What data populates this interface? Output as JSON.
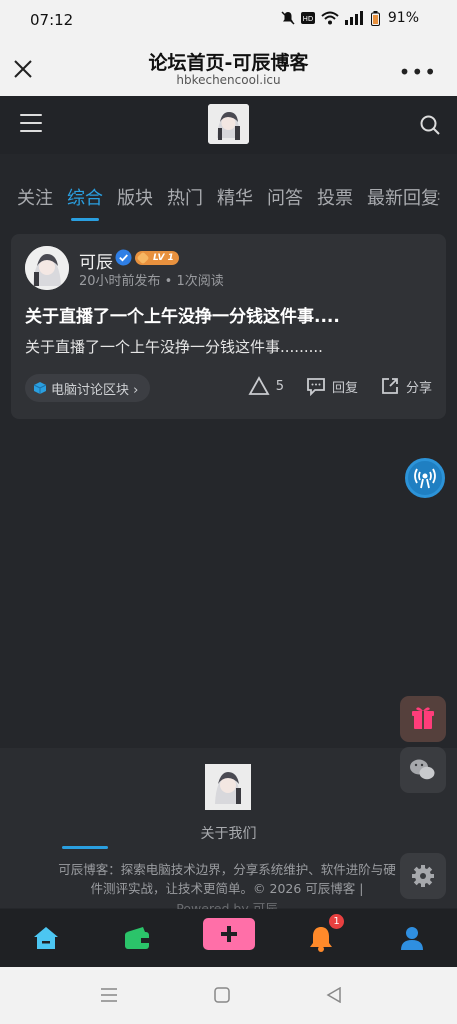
{
  "status_bar": {
    "time": "07:12",
    "battery": "91%",
    "icons": [
      "mute-icon",
      "hd-icon",
      "wifi-icon",
      "signal-icon",
      "battery-icon"
    ]
  },
  "browser": {
    "title": "论坛首页-可辰博客",
    "url": "hbkechencool.icu",
    "menu_label": "•••"
  },
  "tabs": [
    {
      "label": "关注",
      "active": false
    },
    {
      "label": "综合",
      "active": true
    },
    {
      "label": "版块",
      "active": false
    },
    {
      "label": "热门",
      "active": false
    },
    {
      "label": "精华",
      "active": false
    },
    {
      "label": "问答",
      "active": false
    },
    {
      "label": "投票",
      "active": false
    },
    {
      "label": "最新回复",
      "active": false
    }
  ],
  "tabs_more": ":",
  "post": {
    "author": "可辰",
    "level": "LV 1",
    "meta": "20小时前发布 • 1次阅读",
    "title": "关于直播了一个上午没挣一分钱这件事....",
    "excerpt": "关于直播了一个上午没挣一分钱这件事.........",
    "category": "电脑讨论区块 ›",
    "likes": "5",
    "reply_label": "回复",
    "share_label": "分享"
  },
  "footer": {
    "about": "关于我们",
    "desc": "可辰博客：探索电脑技术边界，分享系统维护、软件进阶与硬件测评实战，让技术更简单。© 2026 可辰博客 |",
    "desc_2": "Powered by 可辰"
  },
  "tabbar": {
    "items": [
      "home-icon",
      "wallet-icon",
      "add-icon",
      "bell-icon",
      "user-icon"
    ],
    "notification_count": "1"
  },
  "colors": {
    "accent": "#2a9fe0",
    "background": "#25272b",
    "card": "#303236",
    "level_badge": "#e8913e",
    "add_button": "#ff6fa8"
  }
}
